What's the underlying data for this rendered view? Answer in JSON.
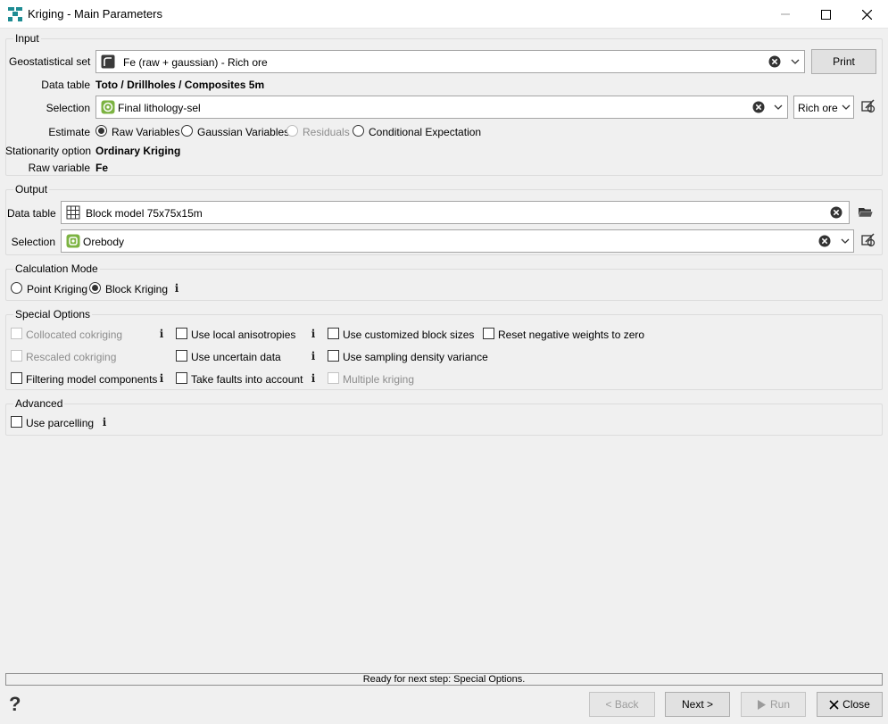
{
  "window": {
    "title": "Kriging - Main Parameters",
    "icon": "kriging-app-icon"
  },
  "input": {
    "group_title": "Input",
    "geostat_label": "Geostatistical set",
    "geostat_value": "Fe (raw + gaussian) - Rich ore",
    "print_label": "Print",
    "datatable_label": "Data table",
    "datatable_value": "Toto / Drillholes / Composites 5m",
    "selection_label": "Selection",
    "selection_value": "Final lithology-sel",
    "selection_right_value": "Rich ore",
    "estimate_label": "Estimate",
    "estimate_options": [
      "Raw Variables",
      "Gaussian Variables",
      "Residuals",
      "Conditional Expectation"
    ],
    "stationarity_label": "Stationarity option",
    "stationarity_value": "Ordinary Kriging",
    "rawvar_label": "Raw variable",
    "rawvar_value": "Fe"
  },
  "output": {
    "group_title": "Output",
    "datatable_label": "Data table",
    "datatable_value": "Block model 75x75x15m",
    "selection_label": "Selection",
    "selection_value": "Orebody"
  },
  "calc_mode": {
    "group_title": "Calculation Mode",
    "options": [
      "Point Kriging",
      "Block Kriging"
    ],
    "selected": "Block Kriging"
  },
  "special": {
    "group_title": "Special Options",
    "col1": [
      "Collocated cokriging",
      "Rescaled cokriging",
      "Filtering model components"
    ],
    "col2": [
      "Use local anisotropies",
      "Use uncertain data",
      "Take faults into account"
    ],
    "col3": [
      "Use customized block sizes",
      "Use sampling density variance",
      "Multiple kriging"
    ],
    "col4": [
      "Reset negative weights to zero"
    ]
  },
  "advanced": {
    "group_title": "Advanced",
    "parcelling_label": "Use parcelling"
  },
  "status": {
    "text": "Ready for next step: Special Options."
  },
  "footer": {
    "help": "?",
    "back_label": "< Back",
    "next_label": "Next >",
    "run_label": "Run",
    "close_label": "Close"
  },
  "colors": {
    "accent_teal": "#1e8c93",
    "selection_green": "#7cb342"
  }
}
